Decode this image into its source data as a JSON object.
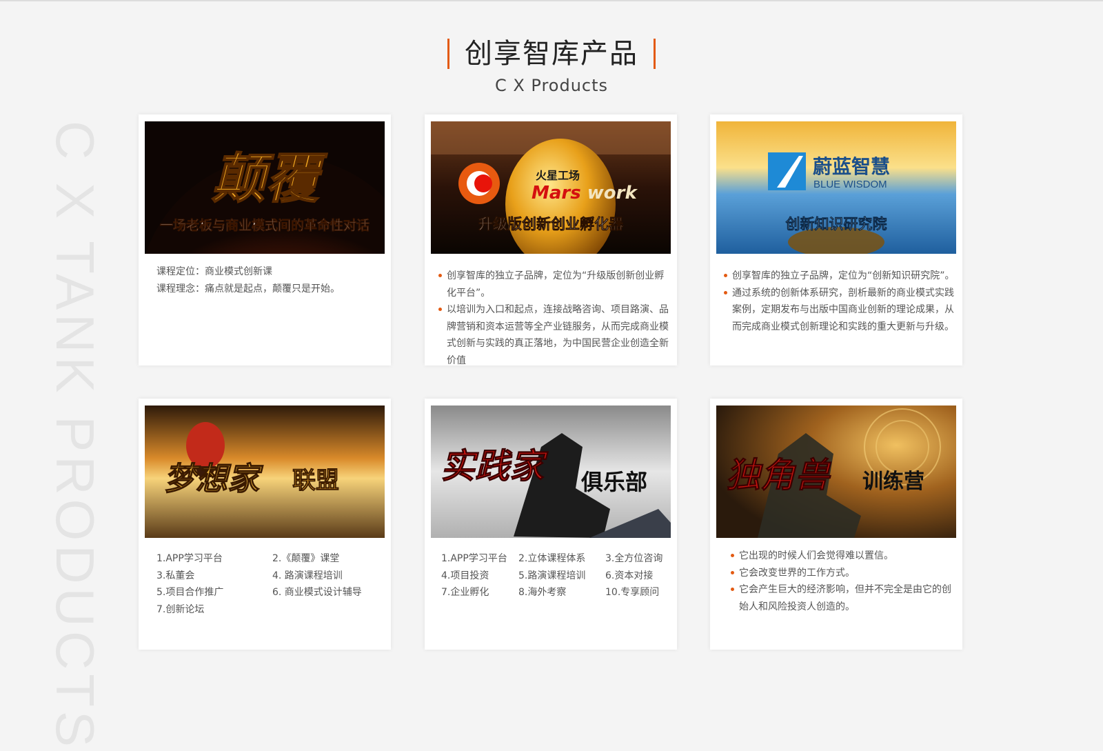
{
  "header": {
    "title": "创享智库产品",
    "subtitle": "C X Products"
  },
  "side_watermark": "C X TANK PRODUCTS",
  "colors": {
    "accent": "#e35a12",
    "background": "#f4f4f4",
    "card": "#ffffff"
  },
  "cards": [
    {
      "banner": {
        "big_text": "颠覆",
        "caption": "一场老板与商业模式间的革命性对话"
      },
      "lines": [
        "课程定位：商业模式创新课",
        "课程理念：痛点就是起点，颠覆只是开始。"
      ]
    },
    {
      "banner": {
        "logo_cn": "火星工场",
        "logo_en_1": "Mars ",
        "logo_en_2": "work",
        "caption": "升级版创新创业孵化器"
      },
      "bullets": [
        "创享智库的独立子品牌，定位为“升级版创新创业孵化平台”。",
        "以培训为入口和起点，连接战略咨询、项目路演、品牌营销和资本运营等全产业链服务，从而完成商业模式创新与实践的真正落地，为中国民营企业创造全新价值"
      ]
    },
    {
      "banner": {
        "logo_cn": "蔚蓝智慧",
        "logo_en": "BLUE WISDOM",
        "caption": "创新知识研究院"
      },
      "bullets": [
        "创享智库的独立子品牌，定位为“创新知识研究院”。",
        "通过系统的创新体系研究，剖析最新的商业模式实践案例，定期发布与出版中国商业创新的理论成果，从而完成商业模式创新理论和实践的重大更新与升级。"
      ]
    },
    {
      "banner": {
        "script_text": "梦想家",
        "suffix": "联盟"
      },
      "items": [
        "1.APP学习平台",
        "2.《颠覆》课堂",
        "3.私董会",
        "4.  路演课程培训",
        "5.项目合作推广",
        "6. 商业模式设计辅导",
        "7.创新论坛"
      ]
    },
    {
      "banner": {
        "script_text": "实践家",
        "suffix": "俱乐部"
      },
      "items": [
        "1.APP学习平台",
        "2.立体课程体系",
        "3.全方位咨询",
        "4.项目投资",
        "5.路演课程培训",
        "6.资本对接",
        "7.企业孵化",
        "8.海外考察",
        "10.专享顾问"
      ]
    },
    {
      "banner": {
        "script_text": "独角兽",
        "suffix": "训练营"
      },
      "bullets": [
        "它出现的时候人们会觉得难以置信。",
        "它会改变世界的工作方式。",
        "它会产生巨大的经济影响，但并不完全是由它的创始人和风险投资人创造的。"
      ]
    }
  ]
}
